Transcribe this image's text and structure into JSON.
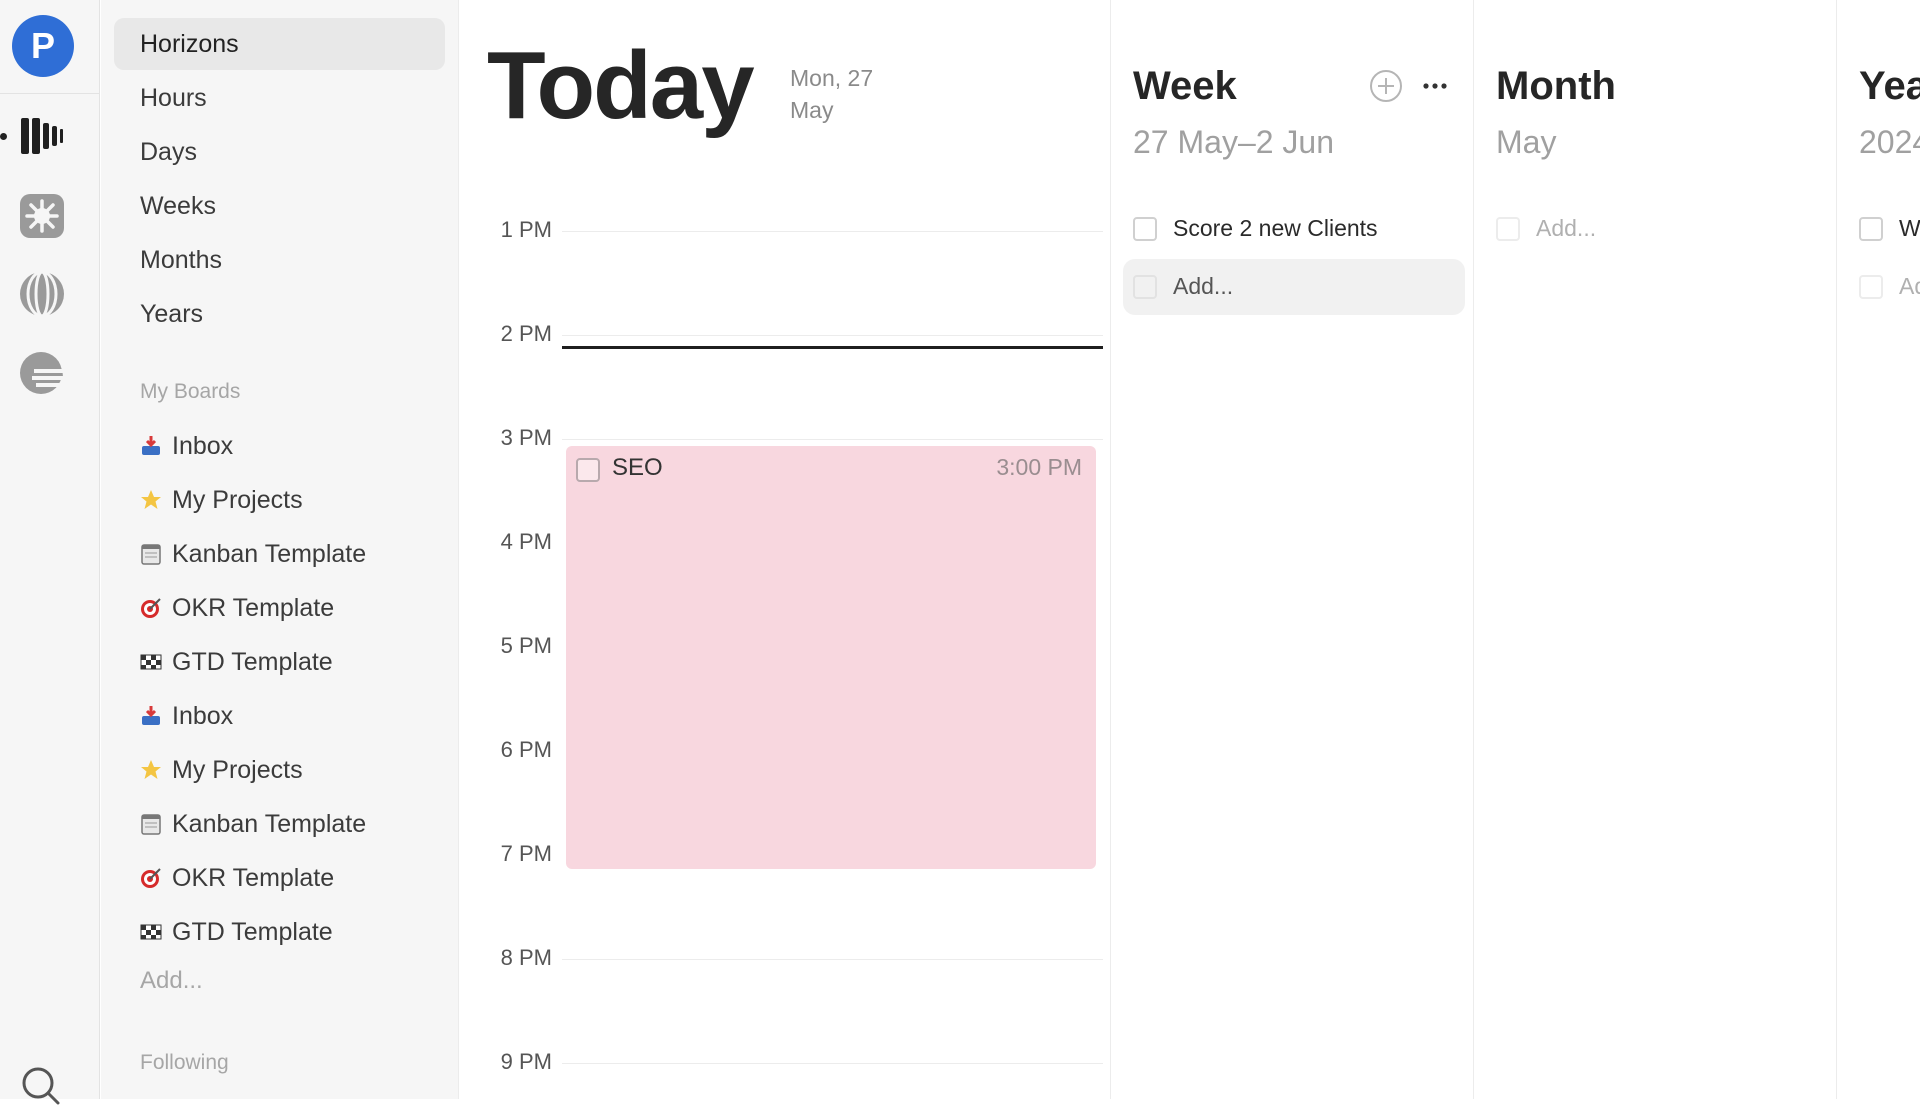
{
  "rail": {
    "avatar_letter": "P",
    "accent_color": "#2f6ed6",
    "icons": [
      "horizons-bars-icon",
      "star-burst-icon",
      "globe-icon",
      "sunset-icon",
      "search-icon"
    ]
  },
  "sidebar": {
    "nav": [
      "Horizons",
      "Hours",
      "Days",
      "Weeks",
      "Months",
      "Years"
    ],
    "active": "Horizons",
    "boards_heading": "My Boards",
    "boards": [
      {
        "emoji": "inbox-tray-icon",
        "label": "Inbox"
      },
      {
        "emoji": "star-icon",
        "label": "My Projects"
      },
      {
        "emoji": "notepad-icon",
        "label": "Kanban Template"
      },
      {
        "emoji": "target-icon",
        "label": "OKR Template"
      },
      {
        "emoji": "checkered-flag-icon",
        "label": "GTD Template"
      },
      {
        "emoji": "inbox-tray-icon",
        "label": "Inbox"
      },
      {
        "emoji": "star-icon",
        "label": "My Projects"
      },
      {
        "emoji": "notepad-icon",
        "label": "Kanban Template"
      },
      {
        "emoji": "target-icon",
        "label": "OKR Template"
      },
      {
        "emoji": "checkered-flag-icon",
        "label": "GTD Template"
      }
    ],
    "add_board": "Add...",
    "following_heading": "Following"
  },
  "today": {
    "title": "Today",
    "date_line1": "Mon, 27",
    "date_line2": "May",
    "hours": [
      "1 PM",
      "2 PM",
      "3 PM",
      "4 PM",
      "5 PM",
      "6 PM",
      "7 PM",
      "8 PM",
      "9 PM"
    ],
    "event": {
      "title": "SEO",
      "time": "3:00 PM",
      "color": "#f8d7df"
    }
  },
  "week": {
    "title": "Week",
    "range": "27 May–2 Jun",
    "tasks": [
      "Score 2 new Clients"
    ],
    "add": "Add..."
  },
  "month": {
    "title": "Month",
    "sub": "May",
    "add": "Add..."
  },
  "year": {
    "title": "Yea",
    "sub": "2024",
    "task_initial": "W",
    "add": "Ad"
  }
}
